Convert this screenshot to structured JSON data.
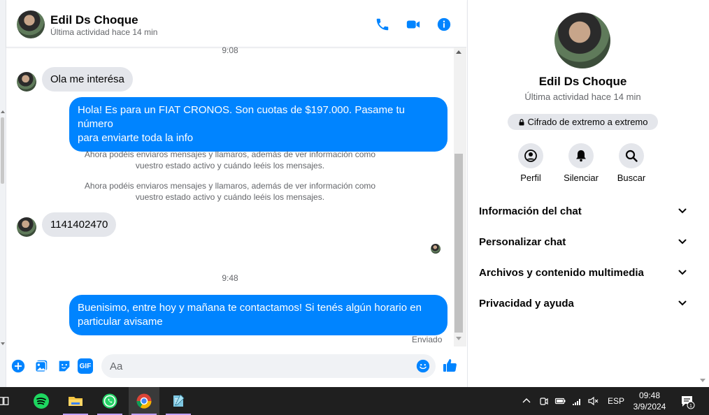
{
  "chat_header": {
    "name": "Edil Ds Choque",
    "status": "Última actividad hace 14 min"
  },
  "messages": {
    "time1": "9:08",
    "in1": "Ola me interésa",
    "out1_line1": "Hola! Es para un FIAT CRONOS. Son cuotas de $197.000. Pasame tu número",
    "out1_line2": "para enviarte toda la info",
    "sys1_line1": "Ahora podéis enviaros mensajes y llamaros, además de ver información como",
    "sys1_line2": "vuestro estado activo y cuándo leéis los mensajes.",
    "sys2_line1": "Ahora podéis enviaros mensajes y llamaros, además de ver información como",
    "sys2_line2": "vuestro estado activo y cuándo leéis los mensajes.",
    "in2": "1141402470",
    "time2": "9:48",
    "out2_line1": "Buenisimo, entre hoy y mañana te contactamos! Si tenés algún horario en",
    "out2_line2": "particular avisame",
    "sent_status": "Enviado"
  },
  "composer": {
    "placeholder": "Aa",
    "gif_label": "GIF"
  },
  "panel": {
    "name": "Edil Ds Choque",
    "status": "Última actividad hace 14 min",
    "e2e": "Cifrado de extremo a extremo",
    "actions": {
      "profile": "Perfil",
      "mute": "Silenciar",
      "search": "Buscar"
    },
    "sections": [
      "Información del chat",
      "Personalizar chat",
      "Archivos y contenido multimedia",
      "Privacidad y ayuda"
    ]
  },
  "taskbar": {
    "language": "ESP",
    "time": "09:48",
    "date": "3/9/2024",
    "notification_count": "1"
  },
  "colors": {
    "accent": "#0084ff",
    "bubble_in": "#e4e6eb",
    "taskbar": "#1f1f1f"
  }
}
